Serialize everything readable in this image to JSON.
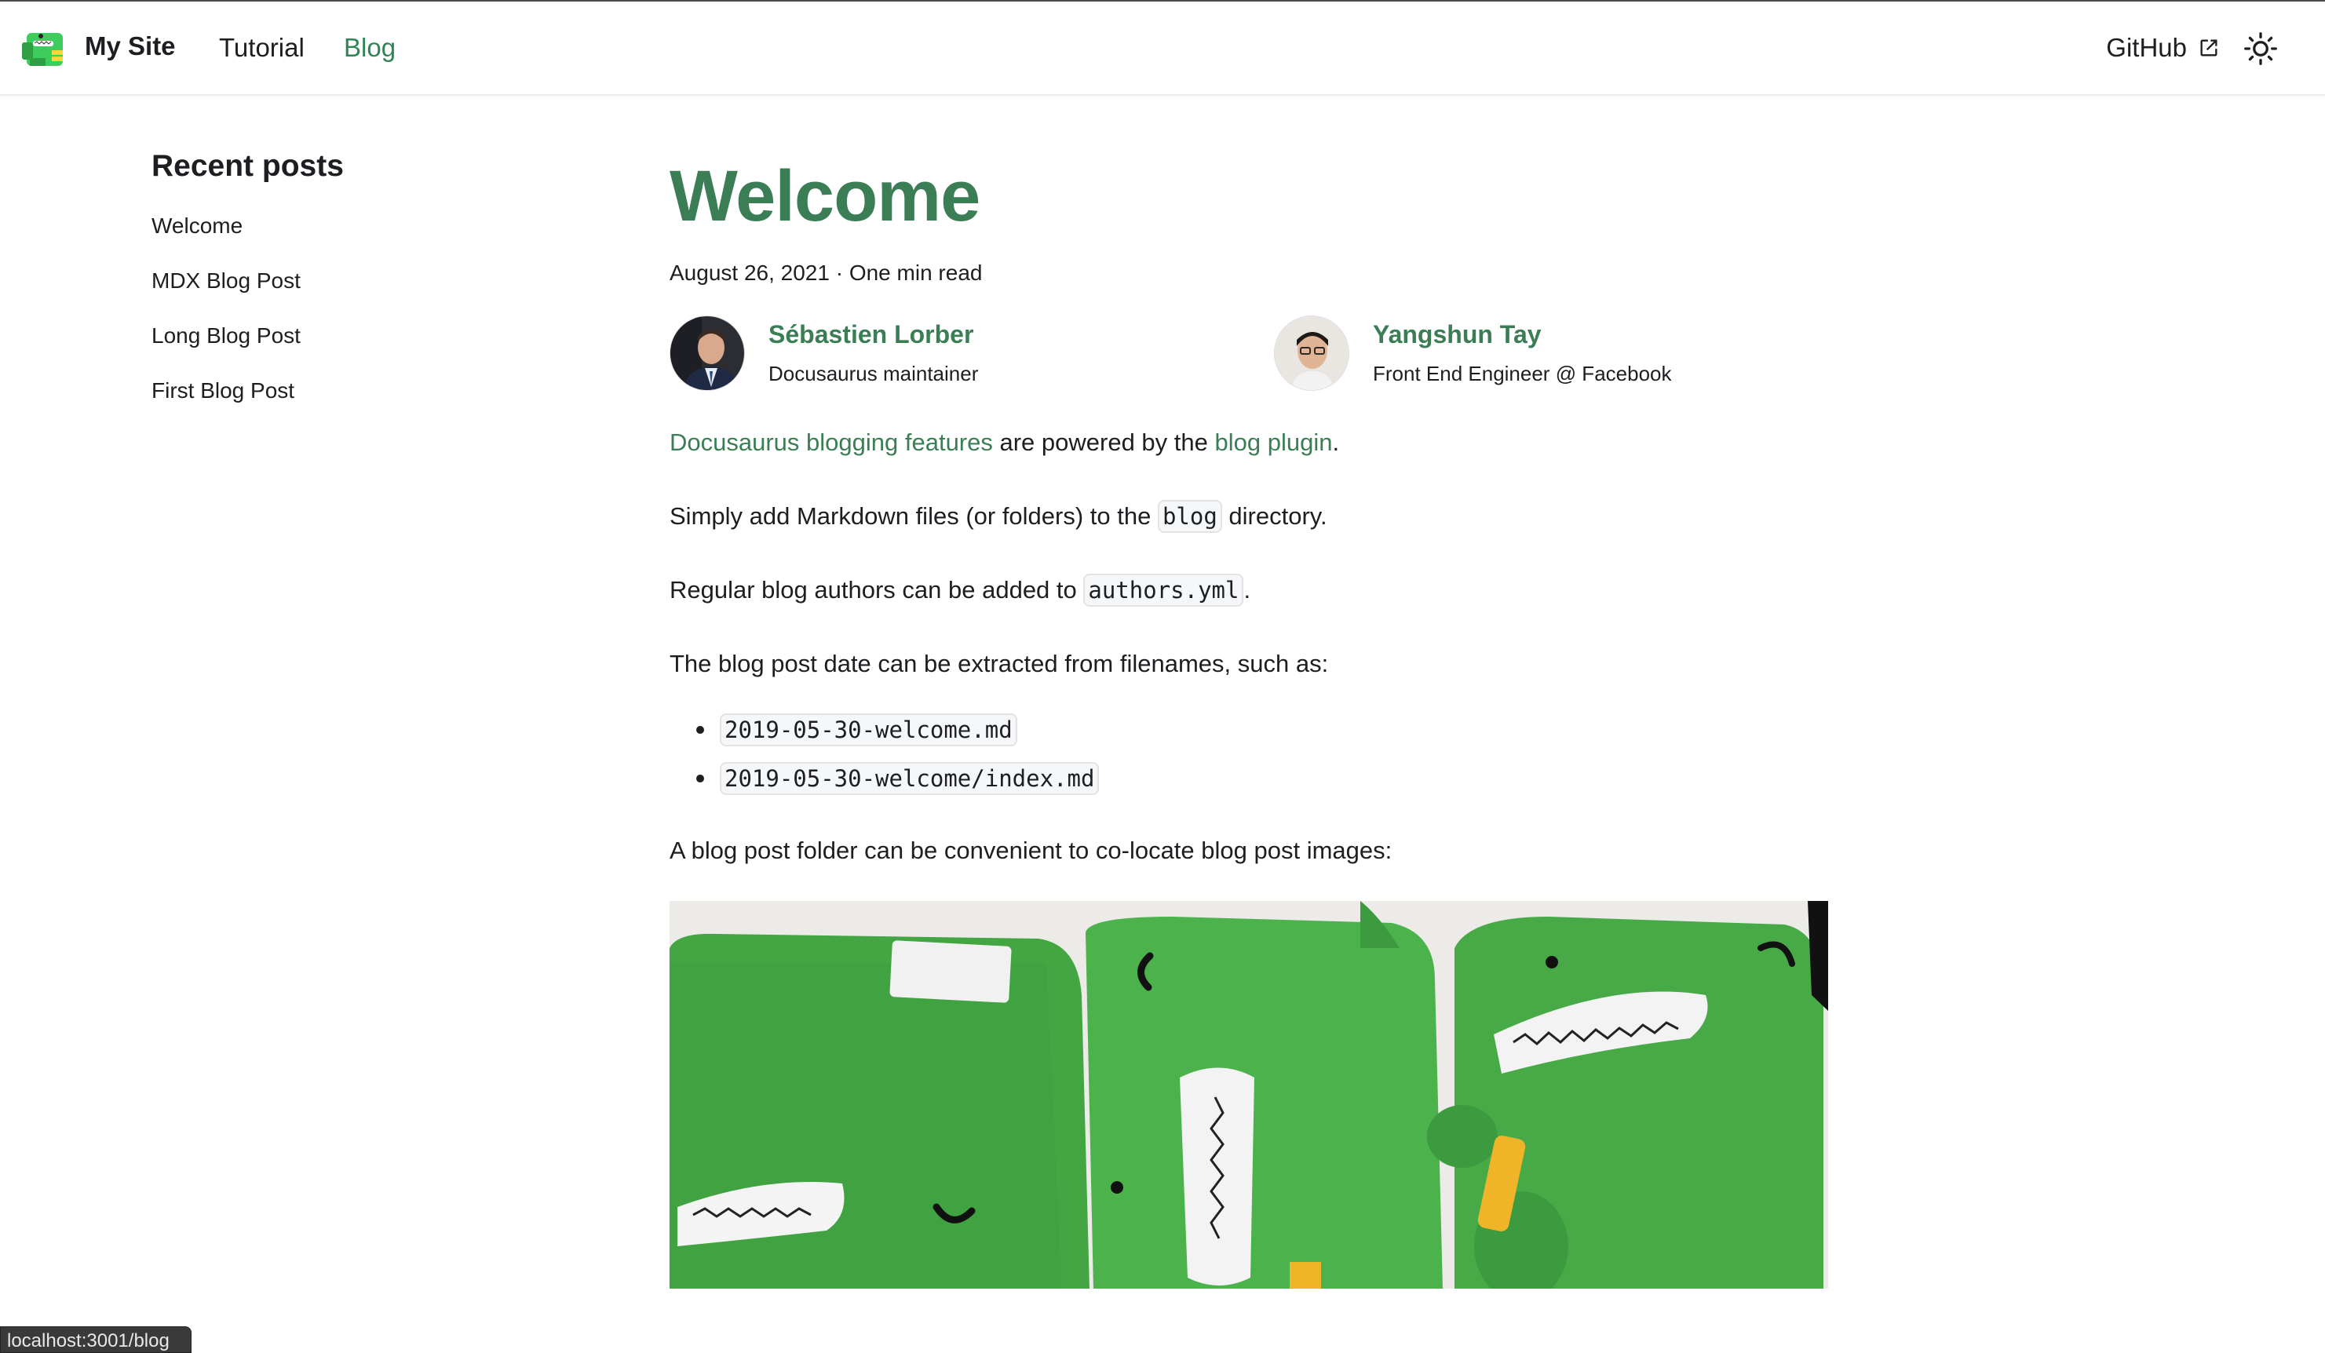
{
  "navbar": {
    "brand": "My Site",
    "links": {
      "tutorial": "Tutorial",
      "blog": "Blog",
      "github": "GitHub"
    },
    "active": "Blog"
  },
  "sidebar": {
    "title": "Recent posts",
    "items": [
      {
        "label": "Welcome"
      },
      {
        "label": "MDX Blog Post"
      },
      {
        "label": "Long Blog Post"
      },
      {
        "label": "First Blog Post"
      }
    ]
  },
  "post": {
    "title": "Welcome",
    "meta": "August 26, 2021 · One min read",
    "authors": [
      {
        "name": "Sébastien Lorber",
        "role": "Docusaurus maintainer"
      },
      {
        "name": "Yangshun Tay",
        "role": "Front End Engineer @ Facebook"
      }
    ],
    "p1": {
      "link1": "Docusaurus blogging features",
      "text1": " are powered by the ",
      "link2": "blog plugin",
      "text2": "."
    },
    "p2": {
      "before": "Simply add Markdown files (or folders) to the ",
      "code": "blog",
      "after": " directory."
    },
    "p3": {
      "before": "Regular blog authors can be added to ",
      "code": "authors.yml",
      "after": "."
    },
    "p4": "The blog post date can be extracted from filenames, such as:",
    "list": [
      "2019-05-30-welcome.md",
      "2019-05-30-welcome/index.md"
    ],
    "p5": "A blog post folder can be convenient to co-locate blog post images:"
  },
  "status": {
    "url": "localhost:3001/blog"
  },
  "colors": {
    "accent": "#2e8555",
    "title": "#3b7e55",
    "text": "#1c1e21"
  }
}
